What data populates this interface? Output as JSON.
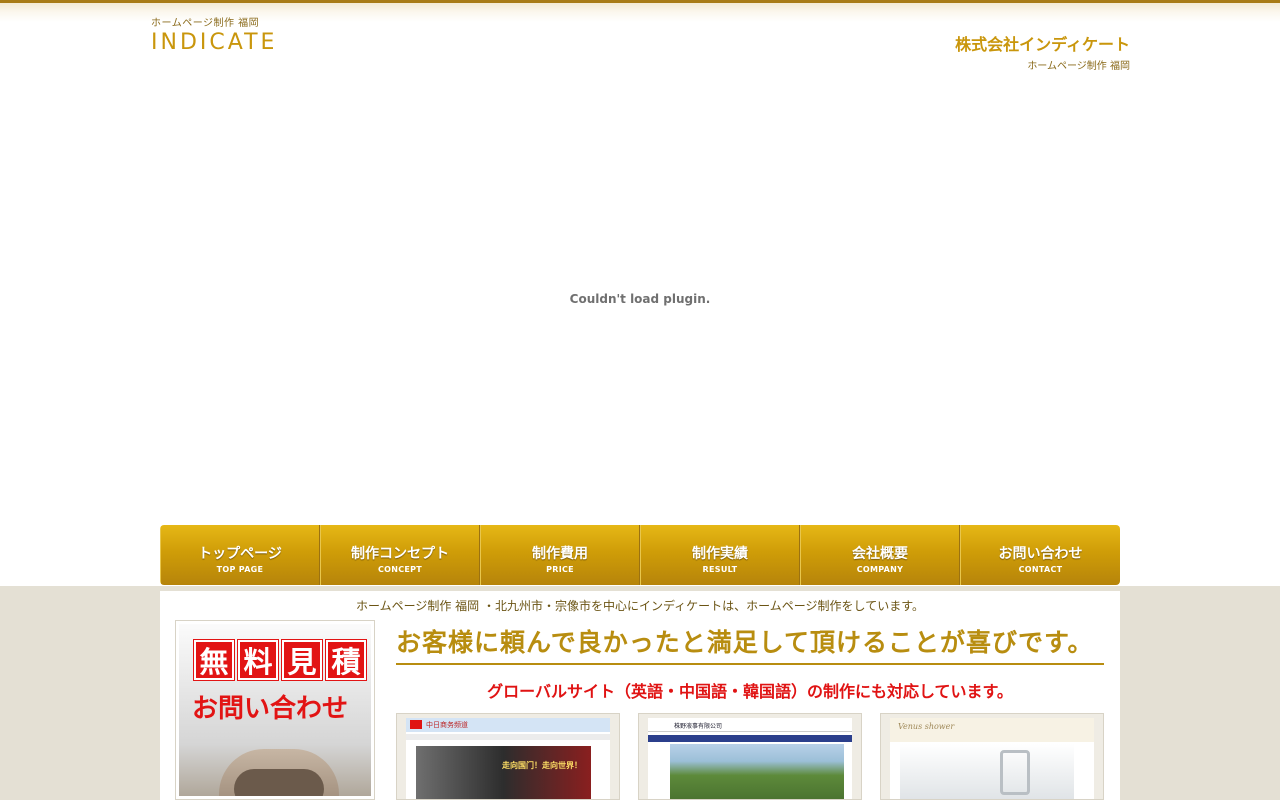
{
  "header": {
    "logo_sub": "ホームページ制作 福岡",
    "logo_main": "INDICATE",
    "company_name": "株式会社インディケート",
    "company_sub": "ホームページ制作 福岡"
  },
  "plugin_message": "Couldn't load plugin.",
  "nav": {
    "items": [
      {
        "jp": "トップページ",
        "en": "TOP PAGE"
      },
      {
        "jp": "制作コンセプト",
        "en": "CONCEPT"
      },
      {
        "jp": "制作費用",
        "en": "PRICE"
      },
      {
        "jp": "制作実績",
        "en": "RESULT"
      },
      {
        "jp": "会社概要",
        "en": "COMPANY"
      },
      {
        "jp": "お問い合わせ",
        "en": "CONTACT"
      }
    ]
  },
  "content": {
    "tagline": "ホームページ制作 福岡 ・北九州市・宗像市を中心にインディケートは、ホームページ制作をしています。",
    "estimate_banner": {
      "chars": [
        "無",
        "料",
        "見",
        "積"
      ],
      "line2": "お問い合わせ"
    },
    "headline": "お客様に頼んで良かったと満足して頂けることが喜びです。",
    "subhead": "グローバルサイト（英語・中国語・韓国語）の制作にも対応しています。",
    "thumbnails": [
      {
        "title": "中日商务频道",
        "hero_text": "走向国门！走向世界！"
      },
      {
        "title": "株野液事有限公司"
      },
      {
        "title": "Venus shower"
      }
    ]
  },
  "colors": {
    "gold": "#c9960c",
    "nav_gold": "#cf9d08",
    "red": "#e01313",
    "lower_bg": "#e4e0d4"
  }
}
